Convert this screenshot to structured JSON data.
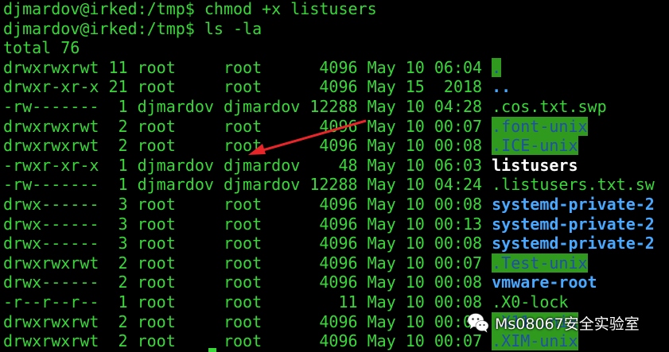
{
  "commands": [
    {
      "prompt": "djmardov@irked:/tmp$ ",
      "command": "chmod +x listusers"
    },
    {
      "prompt": "djmardov@irked:/tmp$ ",
      "command": "ls -la"
    }
  ],
  "total_line": "total 76",
  "listing": [
    {
      "perms": "drwxrwxrwt",
      "links": "11",
      "owner": "root",
      "group": "root",
      "size": "4096",
      "month": "May",
      "day": "10",
      "time": "06:04",
      "name": ".",
      "style": "sticky"
    },
    {
      "perms": "drwxr-xr-x",
      "links": "21",
      "owner": "root",
      "group": "root",
      "size": "4096",
      "month": "May",
      "day": "15",
      "time": "2018",
      "name": "..",
      "style": "dirblue"
    },
    {
      "perms": "-rw-------",
      "links": "1",
      "owner": "djmardov",
      "group": "djmardov",
      "size": "12288",
      "month": "May",
      "day": "10",
      "time": "04:28",
      "name": ".cos.txt.swp",
      "style": "plain"
    },
    {
      "perms": "drwxrwxrwt",
      "links": "2",
      "owner": "root",
      "group": "root",
      "size": "4096",
      "month": "May",
      "day": "10",
      "time": "00:07",
      "name": ".font-unix",
      "style": "sticky"
    },
    {
      "perms": "drwxrwxrwt",
      "links": "2",
      "owner": "root",
      "group": "root",
      "size": "4096",
      "month": "May",
      "day": "10",
      "time": "00:08",
      "name": ".ICE-unix",
      "style": "sticky"
    },
    {
      "perms": "-rwxr-xr-x",
      "links": "1",
      "owner": "djmardov",
      "group": "djmardov",
      "size": "48",
      "month": "May",
      "day": "10",
      "time": "06:03",
      "name": "listusers",
      "style": "exec"
    },
    {
      "perms": "-rw-------",
      "links": "1",
      "owner": "djmardov",
      "group": "djmardov",
      "size": "12288",
      "month": "May",
      "day": "10",
      "time": "04:24",
      "name": ".listusers.txt.sw",
      "style": "plain"
    },
    {
      "perms": "drwx------",
      "links": "3",
      "owner": "root",
      "group": "root",
      "size": "4096",
      "month": "May",
      "day": "10",
      "time": "00:08",
      "name": "systemd-private-2",
      "style": "dirblue"
    },
    {
      "perms": "drwx------",
      "links": "3",
      "owner": "root",
      "group": "root",
      "size": "4096",
      "month": "May",
      "day": "10",
      "time": "00:13",
      "name": "systemd-private-2",
      "style": "dirblue"
    },
    {
      "perms": "drwx------",
      "links": "3",
      "owner": "root",
      "group": "root",
      "size": "4096",
      "month": "May",
      "day": "10",
      "time": "00:08",
      "name": "systemd-private-2",
      "style": "dirblue"
    },
    {
      "perms": "drwxrwxrwt",
      "links": "2",
      "owner": "root",
      "group": "root",
      "size": "4096",
      "month": "May",
      "day": "10",
      "time": "00:07",
      "name": ".Test-unix",
      "style": "sticky"
    },
    {
      "perms": "drwx------",
      "links": "2",
      "owner": "root",
      "group": "root",
      "size": "4096",
      "month": "May",
      "day": "10",
      "time": "00:08",
      "name": "vmware-root",
      "style": "dirblue"
    },
    {
      "perms": "-r--r--r--",
      "links": "1",
      "owner": "root",
      "group": "root",
      "size": "11",
      "month": "May",
      "day": "10",
      "time": "00:08",
      "name": ".X0-lock",
      "style": "plain"
    },
    {
      "perms": "drwxrwxrwt",
      "links": "2",
      "owner": "root",
      "group": "root",
      "size": "4096",
      "month": "May",
      "day": "10",
      "time": "00:07",
      "name": ".X11-unix",
      "style": "sticky"
    },
    {
      "perms": "drwxrwxrwt",
      "links": "2",
      "owner": "root",
      "group": "root",
      "size": "4096",
      "month": "May",
      "day": "10",
      "time": "00:07",
      "name": ".XIM-unix",
      "style": "sticky"
    }
  ],
  "watermark": {
    "text": "Ms08067安全实验室",
    "icon": "wechat-icon"
  },
  "colors": {
    "background": "#000000",
    "text": "#39d839",
    "executable": "#ffffff",
    "directory": "#49a8ff",
    "sticky_fg": "#1f4fa8",
    "sticky_bg": "#2f9a1e",
    "arrow": "#e8262a"
  }
}
